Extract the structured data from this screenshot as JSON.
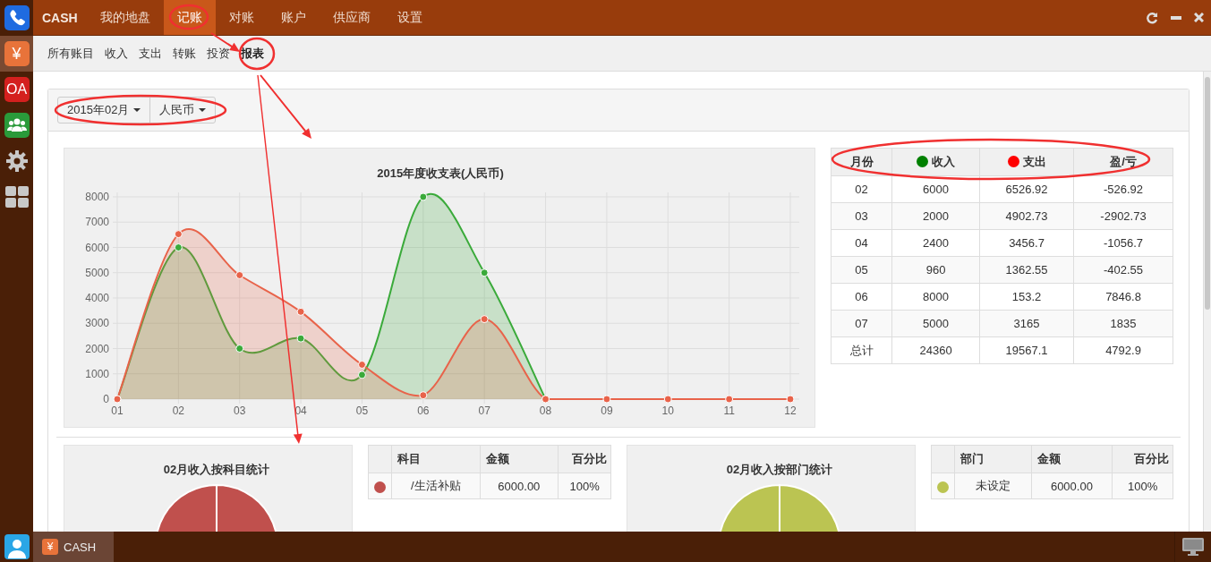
{
  "dock": {
    "apps": [
      {
        "kind": "phone",
        "selected": false
      },
      {
        "kind": "yen",
        "label": "¥",
        "selected": true
      },
      {
        "kind": "oa",
        "label": "OA",
        "selected": false
      },
      {
        "kind": "people",
        "selected": false
      },
      {
        "kind": "gear",
        "selected": false
      },
      {
        "kind": "grid",
        "selected": false
      }
    ]
  },
  "top_nav": {
    "brand": "CASH",
    "items": [
      {
        "label": "我的地盘",
        "selected": false
      },
      {
        "label": "记账",
        "selected": true
      },
      {
        "label": "对账",
        "selected": false
      },
      {
        "label": "账户",
        "selected": false
      },
      {
        "label": "供应商",
        "selected": false
      },
      {
        "label": "设置",
        "selected": false
      }
    ]
  },
  "sub_nav": {
    "items": [
      {
        "label": "所有账目",
        "selected": false
      },
      {
        "label": "收入",
        "selected": false
      },
      {
        "label": "支出",
        "selected": false
      },
      {
        "label": "转账",
        "selected": false
      },
      {
        "label": "投资",
        "selected": false
      },
      {
        "label": "报表",
        "selected": true
      }
    ]
  },
  "filters": [
    "2015年02月",
    "人民币"
  ],
  "chart": {
    "chart_data": {
      "type": "area",
      "title": "2015年度收支表(人民币)",
      "categories": [
        "01",
        "02",
        "03",
        "04",
        "05",
        "06",
        "07",
        "08",
        "09",
        "10",
        "11",
        "12"
      ],
      "series": [
        {
          "color": "#3aaa3a",
          "values": [
            0,
            6000,
            2000,
            2400,
            960,
            8000,
            5000,
            0,
            null,
            null,
            null,
            null
          ]
        },
        {
          "color": "#e8634a",
          "values": [
            0,
            6526.92,
            4902.73,
            3456.7,
            1362.55,
            153.2,
            3165,
            0,
            0,
            0,
            0,
            0
          ]
        }
      ],
      "grid": true,
      "ylim": [
        0,
        8000
      ],
      "yticks": [
        0,
        1000,
        2000,
        3000,
        4000,
        5000,
        6000,
        7000,
        8000
      ]
    }
  },
  "summary_table": {
    "columns": [
      {
        "label": "月份"
      },
      {
        "label": "收入",
        "color": "#008000"
      },
      {
        "label": "支出",
        "color": "#ff0000"
      },
      {
        "label": "盈/亏"
      }
    ],
    "rows": [
      [
        "02",
        "6000",
        "6526.92",
        "-526.92"
      ],
      [
        "03",
        "2000",
        "4902.73",
        "-2902.73"
      ],
      [
        "04",
        "2400",
        "3456.7",
        "-1056.7"
      ],
      [
        "05",
        "960",
        "1362.55",
        "-402.55"
      ],
      [
        "06",
        "8000",
        "153.2",
        "7846.8"
      ],
      [
        "07",
        "5000",
        "3165",
        "1835"
      ],
      [
        "总计",
        "24360",
        "19567.1",
        "4792.9"
      ]
    ]
  },
  "breakdowns": [
    {
      "title": "02月收入按科目统计",
      "table": {
        "columns": [
          "科目",
          "金额",
          "百分比"
        ],
        "rows": [
          {
            "color": "#c0504d",
            "cells": [
              "/生活补贴",
              "6000.00",
              "100%"
            ]
          }
        ]
      }
    },
    {
      "title": "02月收入按部门统计",
      "table": {
        "columns": [
          "部门",
          "金额",
          "百分比"
        ],
        "rows": [
          {
            "color": "#bbc452",
            "cells": [
              "未设定",
              "6000.00",
              "100%"
            ]
          }
        ]
      }
    }
  ],
  "taskbar": {
    "apps": [
      {
        "label": "CASH",
        "icon": "¥",
        "selected": true
      }
    ]
  }
}
